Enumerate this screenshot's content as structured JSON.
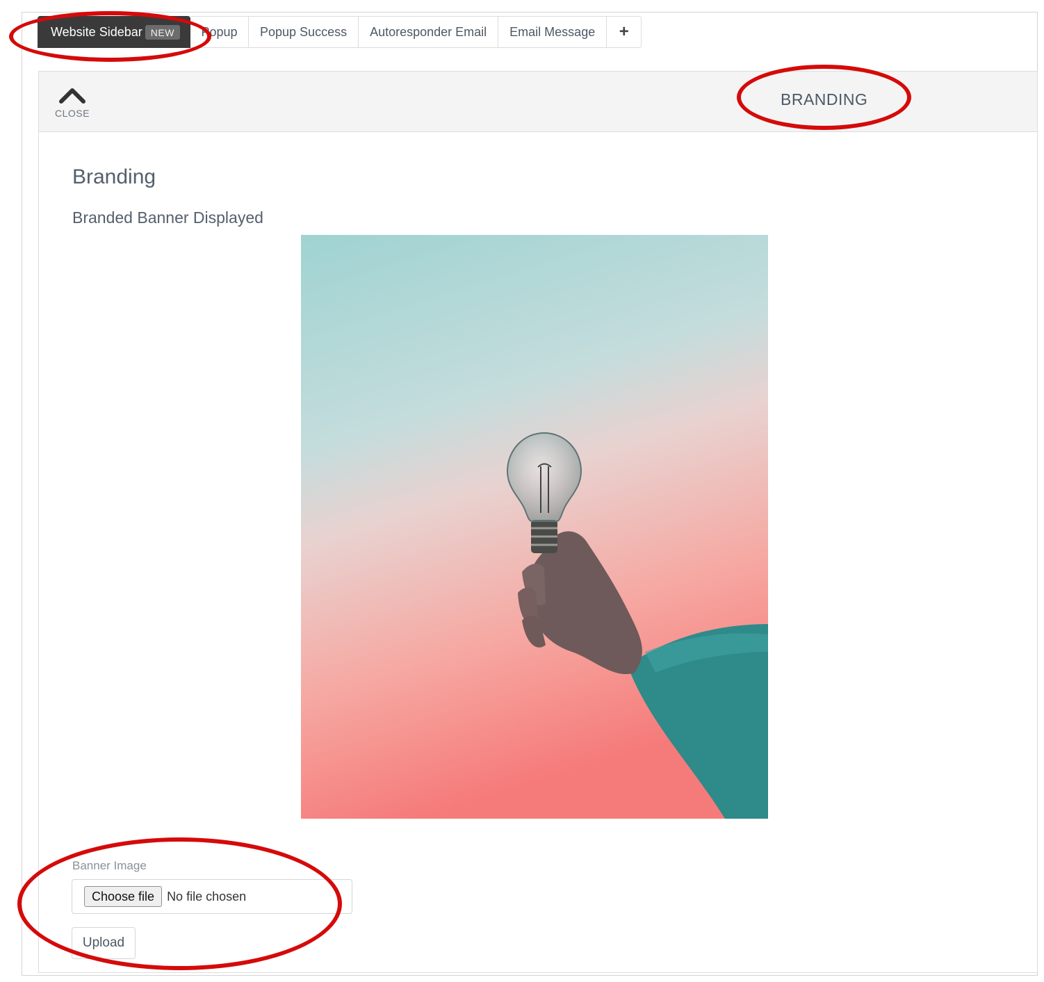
{
  "tabs": [
    {
      "label": "Website Sidebar",
      "badge": "NEW",
      "active": true
    },
    {
      "label": "Popup"
    },
    {
      "label": "Popup Success"
    },
    {
      "label": "Autoresponder Email"
    },
    {
      "label": "Email Message"
    },
    {
      "label": "+"
    }
  ],
  "panel": {
    "close_label": "CLOSE",
    "header_title": "BRANDING",
    "section_title": "Branding",
    "section_subtitle": "Branded Banner Displayed"
  },
  "banner_field": {
    "label": "Banner Image",
    "choose_button": "Choose file",
    "status": "No file chosen",
    "upload_button": "Upload"
  },
  "colors": {
    "annotation": "#d50a0a",
    "active_tab": "#3a3a3a"
  }
}
